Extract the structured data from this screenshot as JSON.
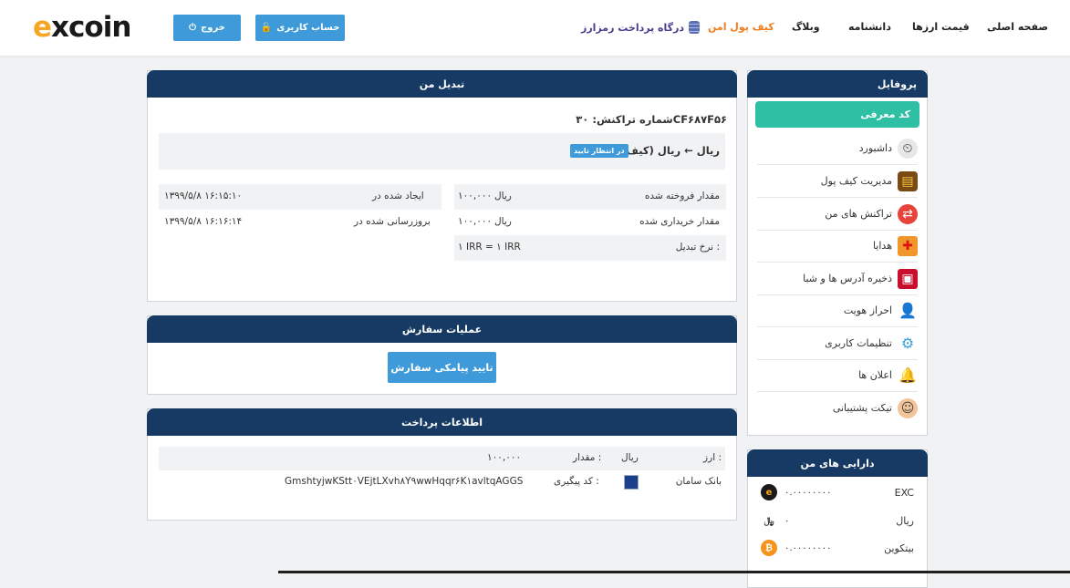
{
  "brand": {
    "logo_text": "excoin"
  },
  "header": {
    "logout_label": "خروج",
    "account_label": "حساب کاربری",
    "nav": {
      "gateway": "درگاه پرداخت رمزارز",
      "wallet": "کیف پول امن",
      "blog": "وبلاگ",
      "academy": "دانشنامه",
      "prices": "قیمت ارزها",
      "home": "صفحه اصلی"
    }
  },
  "exchange": {
    "title": "تبدیل من",
    "tx_label": "شماره تراکنش:",
    "tx_id": "۳۰CF۶۸۷F۵۶",
    "pair": "ریال ← ریال (کیف پول)",
    "status": "در انتظار تایید",
    "created_label": "ایجاد شده در",
    "created_value": "۱۳۹۹/۵/۸ ۱۶:۱۵:۱۰",
    "updated_label": "بروزرسانی شده در",
    "updated_value": "۱۳۹۹/۵/۸ ۱۶:۱۶:۱۴",
    "sold_label": "مقدار فروخته شده",
    "sold_currency": "ریال",
    "sold_value": "۱۰۰,۰۰۰",
    "bought_label": "مقدار خریداری شده",
    "bought_currency": "ریال",
    "bought_value": "۱۰۰,۰۰۰",
    "rate_label": "نرخ تبدیل :",
    "rate_value": "۱ IRR = ۱ IRR"
  },
  "order_ops": {
    "title": "عملیات سفارش",
    "confirm_label": "تایید پیامکی سفارش"
  },
  "payment": {
    "title": "اطلاعات پرداخت",
    "currency_label": "ارز :",
    "currency_value": "ریال",
    "amount_label": "مقدار :",
    "amount_value": "۱۰۰,۰۰۰",
    "bank_name": "بانک سامان",
    "tracking_label": "کد پیگیری :",
    "tracking_value": "GmshtyjwKStt۰VEjtLXvh۸Y۹wwHqqr۶K۱avltqAGGS"
  },
  "profile": {
    "title": "پروفایل",
    "referral_label": "کد معرفی",
    "items": [
      {
        "label": "داشبورد",
        "icon": "speedometer-icon"
      },
      {
        "label": "مدیریت کیف پول",
        "icon": "wallet-icon"
      },
      {
        "label": "تراکنش های من",
        "icon": "transactions-icon"
      },
      {
        "label": "هدایا",
        "icon": "gift-icon"
      },
      {
        "label": "ذخیره آدرس ها و شبا",
        "icon": "save-icon"
      },
      {
        "label": "احراز هویت",
        "icon": "user-verify-icon"
      },
      {
        "label": "تنظیمات کاربری",
        "icon": "settings-icon"
      },
      {
        "label": "اعلان ها",
        "icon": "bell-icon"
      },
      {
        "label": "تیکت پشتیبانی",
        "icon": "support-icon"
      }
    ]
  },
  "assets": {
    "title": "دارایی های من",
    "items": [
      {
        "name": "EXC",
        "amount": "۰.۰۰۰۰۰۰۰۰",
        "icon": "exc-coin-icon",
        "color": "#1a1a1a"
      },
      {
        "name": "ریال",
        "amount": "۰",
        "icon": "rial-icon",
        "color": "#ffffff"
      },
      {
        "name": "بیتکوین",
        "amount": "۰.۰۰۰۰۰۰۰۰",
        "icon": "bitcoin-icon",
        "color": "#f7931a"
      }
    ]
  },
  "colors": {
    "navy": "#163a63",
    "blue_button": "#3e9ad8",
    "teal": "#2ebfa5",
    "orange_nav": "#f07c1d"
  }
}
